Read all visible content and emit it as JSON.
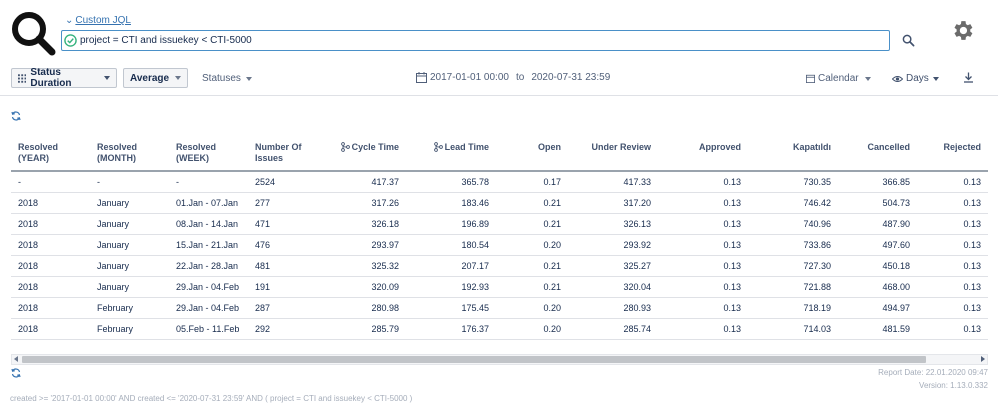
{
  "header": {
    "jql_link": "Custom JQL",
    "jql_query": "project = CTI and issuekey < CTI-5000"
  },
  "toolbar": {
    "status_duration": "Status Duration",
    "average": "Average",
    "statuses": "Statuses",
    "date_from": "2017-01-01 00:00",
    "date_to_label": "to",
    "date_to": "2020-07-31 23:59",
    "calendar": "Calendar",
    "days": "Days"
  },
  "table": {
    "headers": [
      {
        "l1": "Resolved (YEAR)",
        "l2": ""
      },
      {
        "l1": "Resolved",
        "l2": "(MONTH)"
      },
      {
        "l1": "Resolved",
        "l2": "(WEEK)"
      },
      {
        "l1": "Number Of",
        "l2": "Issues"
      },
      {
        "l1": "Cycle Time",
        "l2": ""
      },
      {
        "l1": "Lead Time",
        "l2": ""
      },
      {
        "l1": "Open",
        "l2": ""
      },
      {
        "l1": "Under Review",
        "l2": ""
      },
      {
        "l1": "Approved",
        "l2": ""
      },
      {
        "l1": "Kapatıldı",
        "l2": ""
      },
      {
        "l1": "Cancelled",
        "l2": ""
      },
      {
        "l1": "Rejected",
        "l2": ""
      }
    ],
    "rows": [
      [
        "-",
        "-",
        "-",
        "2524",
        "417.37",
        "365.78",
        "0.17",
        "417.33",
        "0.13",
        "730.35",
        "366.85",
        "0.13"
      ],
      [
        "2018",
        "January",
        "01.Jan - 07.Jan",
        "277",
        "317.26",
        "183.46",
        "0.21",
        "317.20",
        "0.13",
        "746.42",
        "504.73",
        "0.13"
      ],
      [
        "2018",
        "January",
        "08.Jan - 14.Jan",
        "471",
        "326.18",
        "196.89",
        "0.21",
        "326.13",
        "0.13",
        "740.96",
        "487.90",
        "0.13"
      ],
      [
        "2018",
        "January",
        "15.Jan - 21.Jan",
        "476",
        "293.97",
        "180.54",
        "0.20",
        "293.92",
        "0.13",
        "733.86",
        "497.60",
        "0.13"
      ],
      [
        "2018",
        "January",
        "22.Jan - 28.Jan",
        "481",
        "325.32",
        "207.17",
        "0.21",
        "325.27",
        "0.13",
        "727.30",
        "450.18",
        "0.13"
      ],
      [
        "2018",
        "January",
        "29.Jan - 04.Feb",
        "191",
        "320.09",
        "192.93",
        "0.21",
        "320.04",
        "0.13",
        "721.88",
        "468.00",
        "0.13"
      ],
      [
        "2018",
        "February",
        "29.Jan - 04.Feb",
        "287",
        "280.98",
        "175.45",
        "0.20",
        "280.93",
        "0.13",
        "718.19",
        "494.97",
        "0.13"
      ],
      [
        "2018",
        "February",
        "05.Feb - 11.Feb",
        "292",
        "285.79",
        "176.37",
        "0.20",
        "285.74",
        "0.13",
        "714.03",
        "481.59",
        "0.13"
      ]
    ]
  },
  "footer": {
    "report_date": "Report Date: 22.01.2020 09:47",
    "version": "Version: 1.13.0.332",
    "jql": "created >= '2017-01-01 00:00' AND created <= '2020-07-31 23:59' AND ( project = CTI and issuekey < CTI-5000 )"
  },
  "colors": {
    "link": "#3572b0",
    "input_border": "#4a90c8",
    "valid_check": "#36b37e",
    "muted_text": "#a5adba"
  },
  "icons": [
    "magnifier-logo-icon",
    "check-circle-icon",
    "search-icon",
    "gear-icon",
    "grid-icon",
    "calendar-icon",
    "eye-icon",
    "download-icon",
    "refresh-icon",
    "branch-icon"
  ]
}
